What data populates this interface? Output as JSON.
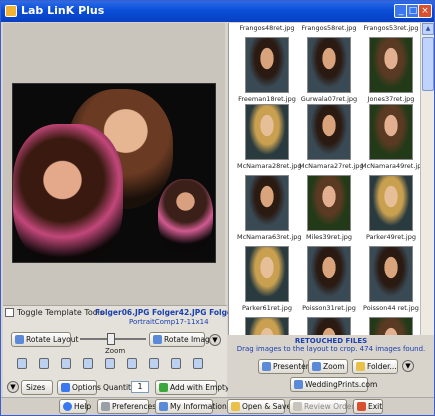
{
  "window": {
    "title": "Lab LinK Plus",
    "min": "_",
    "max": "□",
    "close": "×"
  },
  "tools": {
    "toggle_label": "Toggle Template Tools",
    "filenames": "Folger06.JPG  Folger42.JPG  Folger49.JPG",
    "template_name": "PortraitComp17-11x14",
    "rotate_layout": "Rotate Layout",
    "rotate_image": "Rotate Image",
    "zoom_label": "Zoom",
    "sizes": "Sizes",
    "options": "Options",
    "quantity_label": "Quantity",
    "quantity_value": "1",
    "add_with_empty": "Add with Empty"
  },
  "thumbnails": {
    "top_row": [
      "Frangos48ret.jpg",
      "Frangos58ret.jpg",
      "Frangos53ret.jpg"
    ],
    "rows": [
      [
        "Freeman18ret.jpg",
        "Gurwala07ret.jpg",
        "Jones37ret.jpg"
      ],
      [
        "McNamara28ret.jpg",
        "McNamara27ret.jpg",
        "McNamara49ret.jpg"
      ],
      [
        "McNamara63ret.jpg",
        "Miles39ret.jpg",
        "Parker49ret.jpg"
      ],
      [
        "Parker61ret.jpg",
        "Poisson31ret.jpg",
        "Poisson44 ret.jpg"
      ]
    ]
  },
  "browser_footer": {
    "heading": "RETOUCHED FILES",
    "hint": "Drag images to the layout to crop. 474 images found.",
    "presenter": "Presenter",
    "zoom": "Zoom",
    "folder": "Folder...",
    "weddingprints": "WeddingPrints.com"
  },
  "bottom": {
    "help": "Help",
    "preferences": "Preferences",
    "my_information": "My Information",
    "open_save": "Open & Save",
    "review_order": "Review Order",
    "exit": "Exit"
  }
}
